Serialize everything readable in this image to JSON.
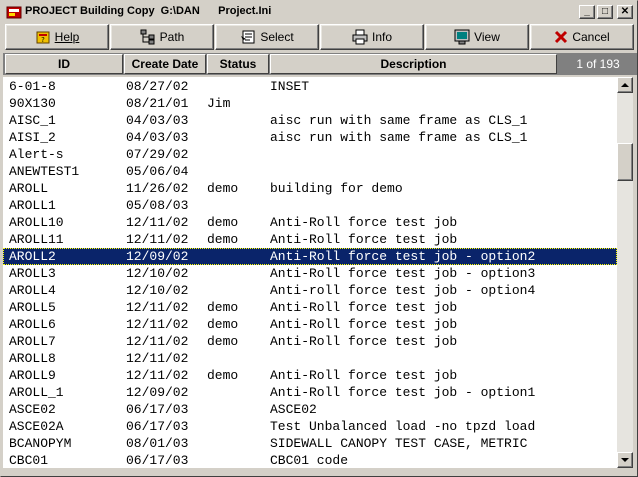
{
  "window": {
    "title": "PROJECT Building Copy  G:\\DAN      Project.Ini",
    "minimize": "_",
    "maximize": "□",
    "close": "✕"
  },
  "toolbar": {
    "help": "Help",
    "path": "Path",
    "select": "Select",
    "info": "Info",
    "view": "View",
    "cancel": "Cancel"
  },
  "columns": {
    "id": "ID",
    "create_date": "Create Date",
    "status": "Status",
    "description": "Description"
  },
  "pagination": "1  of  193",
  "rows": [
    {
      "id": "6-01-8",
      "date": "08/27/02",
      "status": "",
      "desc": "INSET"
    },
    {
      "id": "90X130",
      "date": "08/21/01",
      "status": "Jim",
      "desc": ""
    },
    {
      "id": "AISC_1",
      "date": "04/03/03",
      "status": "",
      "desc": "aisc run with same frame as CLS_1"
    },
    {
      "id": "AISI_2",
      "date": "04/03/03",
      "status": "",
      "desc": "aisc run with same frame as CLS_1"
    },
    {
      "id": "Alert-s",
      "date": "07/29/02",
      "status": "",
      "desc": ""
    },
    {
      "id": "ANEWTEST1",
      "date": "05/06/04",
      "status": "",
      "desc": ""
    },
    {
      "id": "AROLL",
      "date": "11/26/02",
      "status": "demo",
      "desc": "building for demo"
    },
    {
      "id": "AROLL1",
      "date": "05/08/03",
      "status": "",
      "desc": ""
    },
    {
      "id": "AROLL10",
      "date": "12/11/02",
      "status": "demo",
      "desc": "Anti-Roll force test job"
    },
    {
      "id": "AROLL11",
      "date": "12/11/02",
      "status": "demo",
      "desc": "Anti-Roll force test job"
    },
    {
      "id": "AROLL2",
      "date": "12/09/02",
      "status": "",
      "desc": "Anti-Roll force test job - option2"
    },
    {
      "id": "AROLL3",
      "date": "12/10/02",
      "status": "",
      "desc": "Anti-Roll force test job - option3"
    },
    {
      "id": "AROLL4",
      "date": "12/10/02",
      "status": "",
      "desc": "Anti-roll force test job - option4"
    },
    {
      "id": "AROLL5",
      "date": "12/11/02",
      "status": "demo",
      "desc": "Anti-Roll force test job"
    },
    {
      "id": "AROLL6",
      "date": "12/11/02",
      "status": "demo",
      "desc": "Anti-Roll force test job"
    },
    {
      "id": "AROLL7",
      "date": "12/11/02",
      "status": "demo",
      "desc": "Anti-Roll force test job"
    },
    {
      "id": "AROLL8",
      "date": "12/11/02",
      "status": "",
      "desc": ""
    },
    {
      "id": "AROLL9",
      "date": "12/11/02",
      "status": "demo",
      "desc": "Anti-Roll force test job"
    },
    {
      "id": "AROLL_1",
      "date": "12/09/02",
      "status": "",
      "desc": "Anti-Roll force test job - option1"
    },
    {
      "id": "ASCE02",
      "date": "06/17/03",
      "status": "",
      "desc": "ASCE02"
    },
    {
      "id": "ASCE02A",
      "date": "06/17/03",
      "status": "",
      "desc": "Test Unbalanced load -no tpzd load"
    },
    {
      "id": "BCANOPYM",
      "date": "08/01/03",
      "status": "",
      "desc": "SIDEWALL CANOPY TEST CASE, METRIC"
    },
    {
      "id": "CBC01",
      "date": "06/17/03",
      "status": "",
      "desc": "CBC01 code"
    }
  ],
  "selected_index": 10,
  "scroll_position": 0.05,
  "colors": {
    "selection": "#0a246a",
    "face": "#d4d0c8",
    "header_bar": "#808080"
  },
  "icons": {
    "help": "help-book-icon",
    "path": "path-tree-icon",
    "select": "select-pointer-icon",
    "info": "info-printer-icon",
    "view": "view-monitor-icon",
    "cancel": "cancel-x-icon"
  }
}
